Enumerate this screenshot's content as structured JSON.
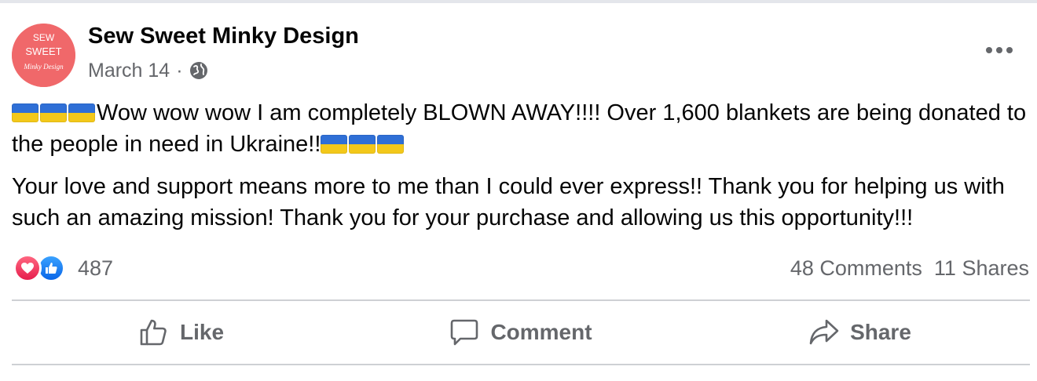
{
  "post": {
    "author": "Sew Sweet Minky Design",
    "avatar_text": {
      "line1": "SEW",
      "line2": "SWEET",
      "line3": "Minky Design"
    },
    "date": "March 14",
    "separator": "·",
    "privacy_icon": "globe-icon",
    "more_icon": "more-options-icon",
    "paragraph1": "Wow wow wow I am completely BLOWN AWAY!!!! Over 1,600 blankets are being donated to the people in need in Ukraine!!",
    "paragraph2": "Your love and support means more to me than I could ever express!! Thank you for helping us with such an amazing mission! Thank you for your purchase and allowing us this opportunity!!!",
    "flag_emoji": "ukraine-flag"
  },
  "engagement": {
    "reaction_icons": [
      "love-icon",
      "like-icon"
    ],
    "reactions_count": "487",
    "comments": "48 Comments",
    "shares": "11 Shares"
  },
  "actions": {
    "like": "Like",
    "comment": "Comment",
    "share": "Share"
  },
  "colors": {
    "avatar_bg": "#f0686a",
    "ukraine_blue": "#2f6fd6",
    "ukraine_yellow": "#f3c81a",
    "secondary_text": "#65676b",
    "love": "#e61e4d",
    "like": "#0a66e8"
  }
}
